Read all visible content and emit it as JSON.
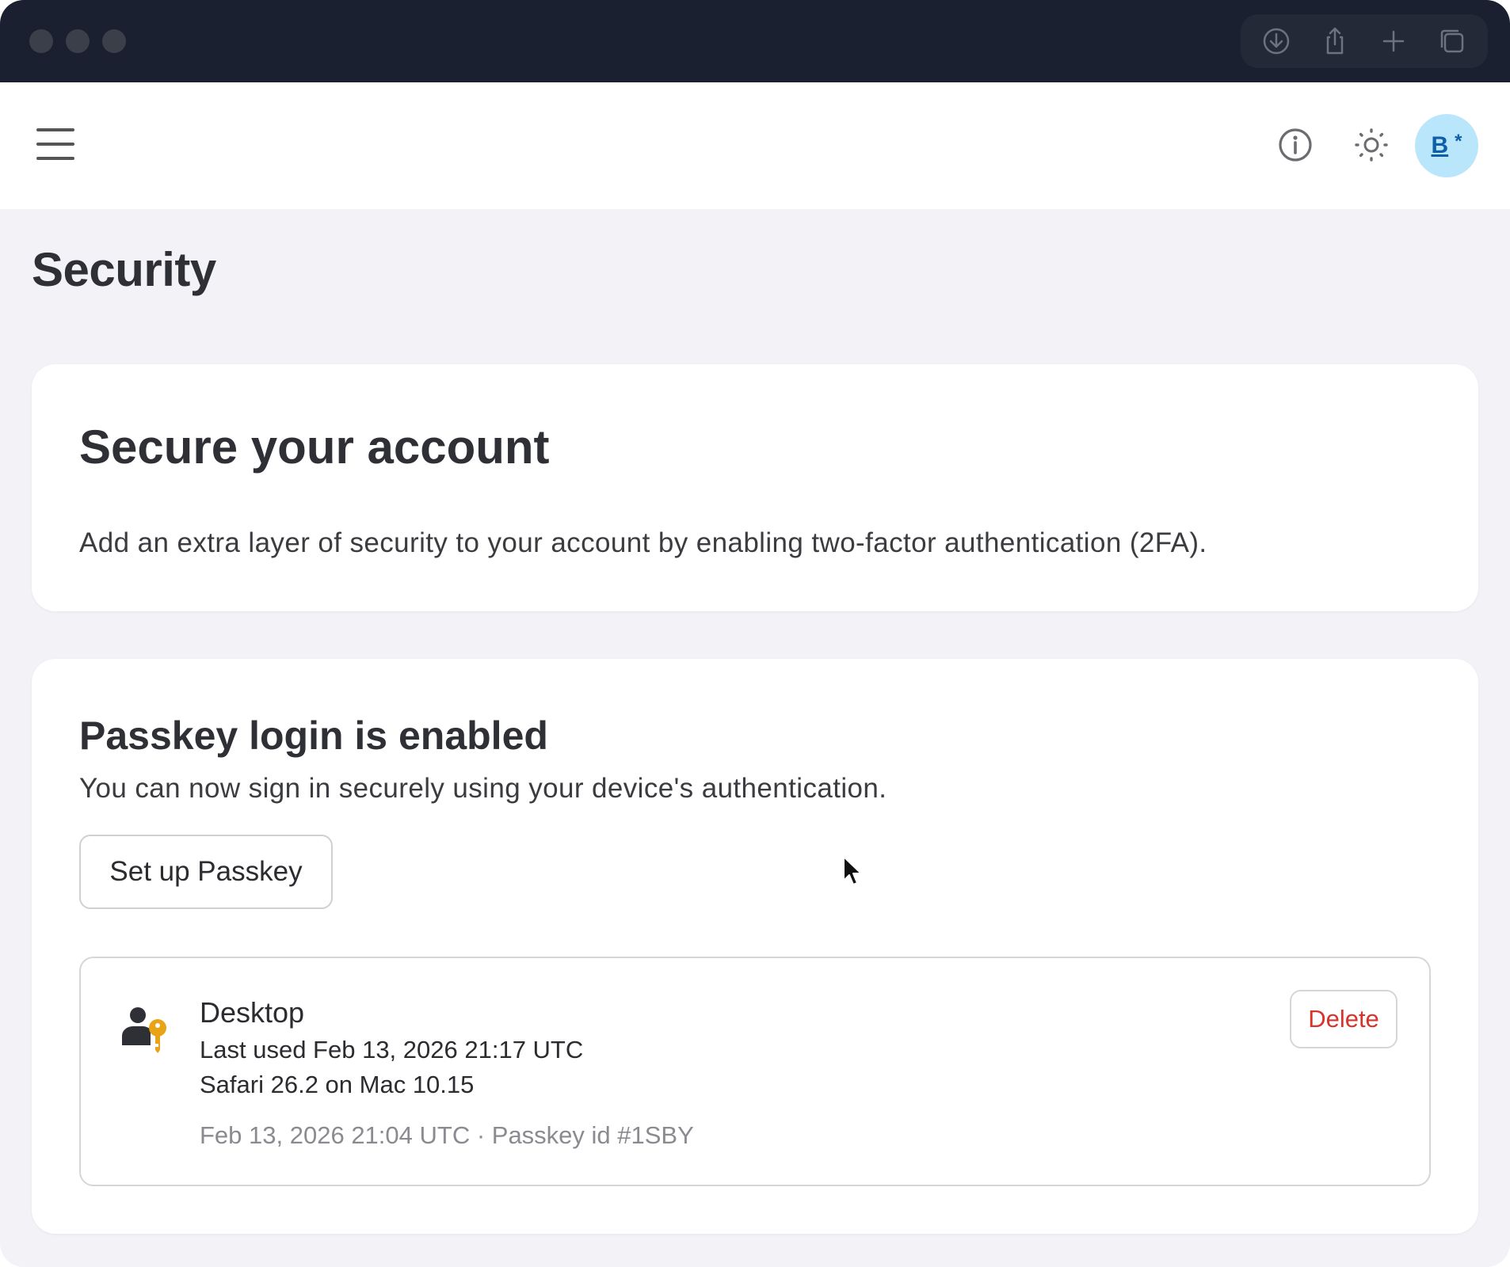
{
  "page": {
    "title": "Security"
  },
  "header": {
    "avatar_initial": "B",
    "avatar_badge": "*",
    "icons": {
      "menu": "hamburger-icon",
      "info": "info-icon",
      "theme": "sun-icon"
    }
  },
  "browser": {
    "toolbar_icons": [
      "download-icon",
      "share-icon",
      "new-tab-icon",
      "tabs-overview-icon"
    ]
  },
  "secure_card": {
    "title": "Secure your account",
    "description": "Add an extra layer of security to your account by enabling two-factor authentication (2FA)."
  },
  "passkey_card": {
    "title": "Passkey login is enabled",
    "description": "You can now sign in securely using your device's authentication.",
    "setup_label": "Set up Passkey",
    "items": [
      {
        "name": "Desktop",
        "last_used": "Last used Feb 13, 2026 21:17 UTC",
        "device": "Safari 26.2 on Mac 10.15",
        "meta": "Feb 13, 2026 21:04 UTC · Passkey id #1SBY",
        "delete_label": "Delete"
      }
    ]
  },
  "colors": {
    "background": "#f2f2f7",
    "titlebar": "#1b2030",
    "avatar_bg": "#b9e6fb",
    "avatar_fg": "#0f5ea8",
    "danger": "#d6342c",
    "key": "#e8a317"
  }
}
